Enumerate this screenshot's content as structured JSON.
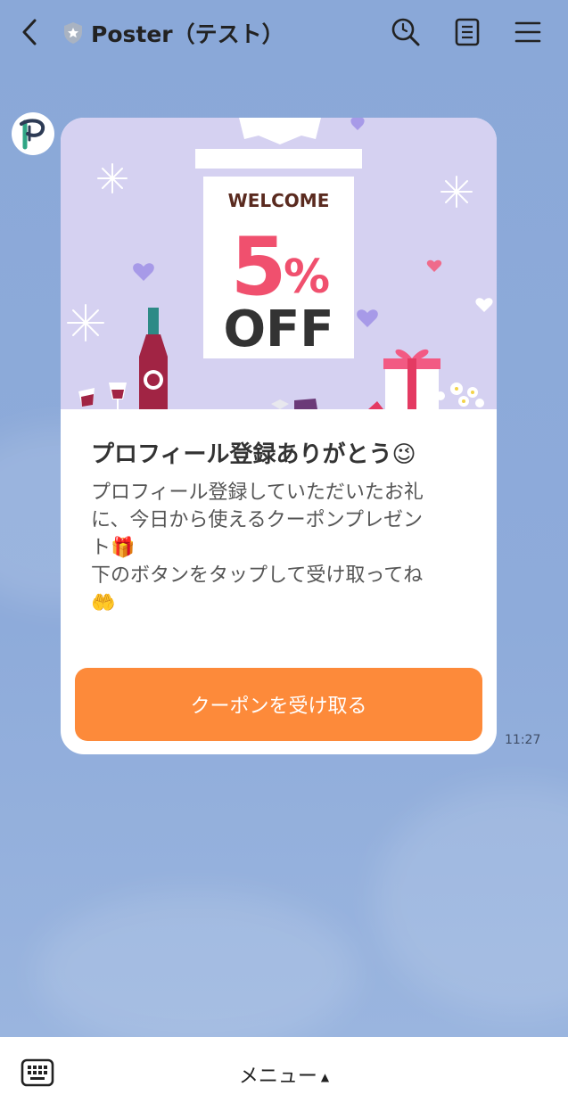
{
  "header": {
    "title": "Poster（テスト）",
    "back_icon": "chevron-left-icon",
    "badge_icon": "shield-star-icon",
    "search_icon": "search-icon",
    "notes_icon": "notes-icon",
    "menu_icon": "hamburger-icon"
  },
  "avatar": {
    "letter": "P",
    "color": "#2fa585"
  },
  "message": {
    "banner": {
      "welcome": "WELCOME",
      "discount_number": "5",
      "discount_percent": "%",
      "off": "OFF"
    },
    "heading": "プロフィール登録ありがとう😉",
    "body_lines": [
      "プロフィール登録していただいたお礼",
      "に、今日から使えるクーポンプレゼン",
      "ト🎁",
      "下のボタンをタップして受け取ってね",
      "🤲"
    ],
    "button_label": "クーポンを受け取る",
    "time": "11:27"
  },
  "bottom_bar": {
    "keyboard_icon": "keyboard-icon",
    "menu_label": "メニュー",
    "menu_arrow": "▲"
  },
  "colors": {
    "background": "#8eabd9",
    "hero_bg": "#d5d1f1",
    "discount_pink": "#f0506e",
    "button_orange": "#fd8a3a"
  }
}
